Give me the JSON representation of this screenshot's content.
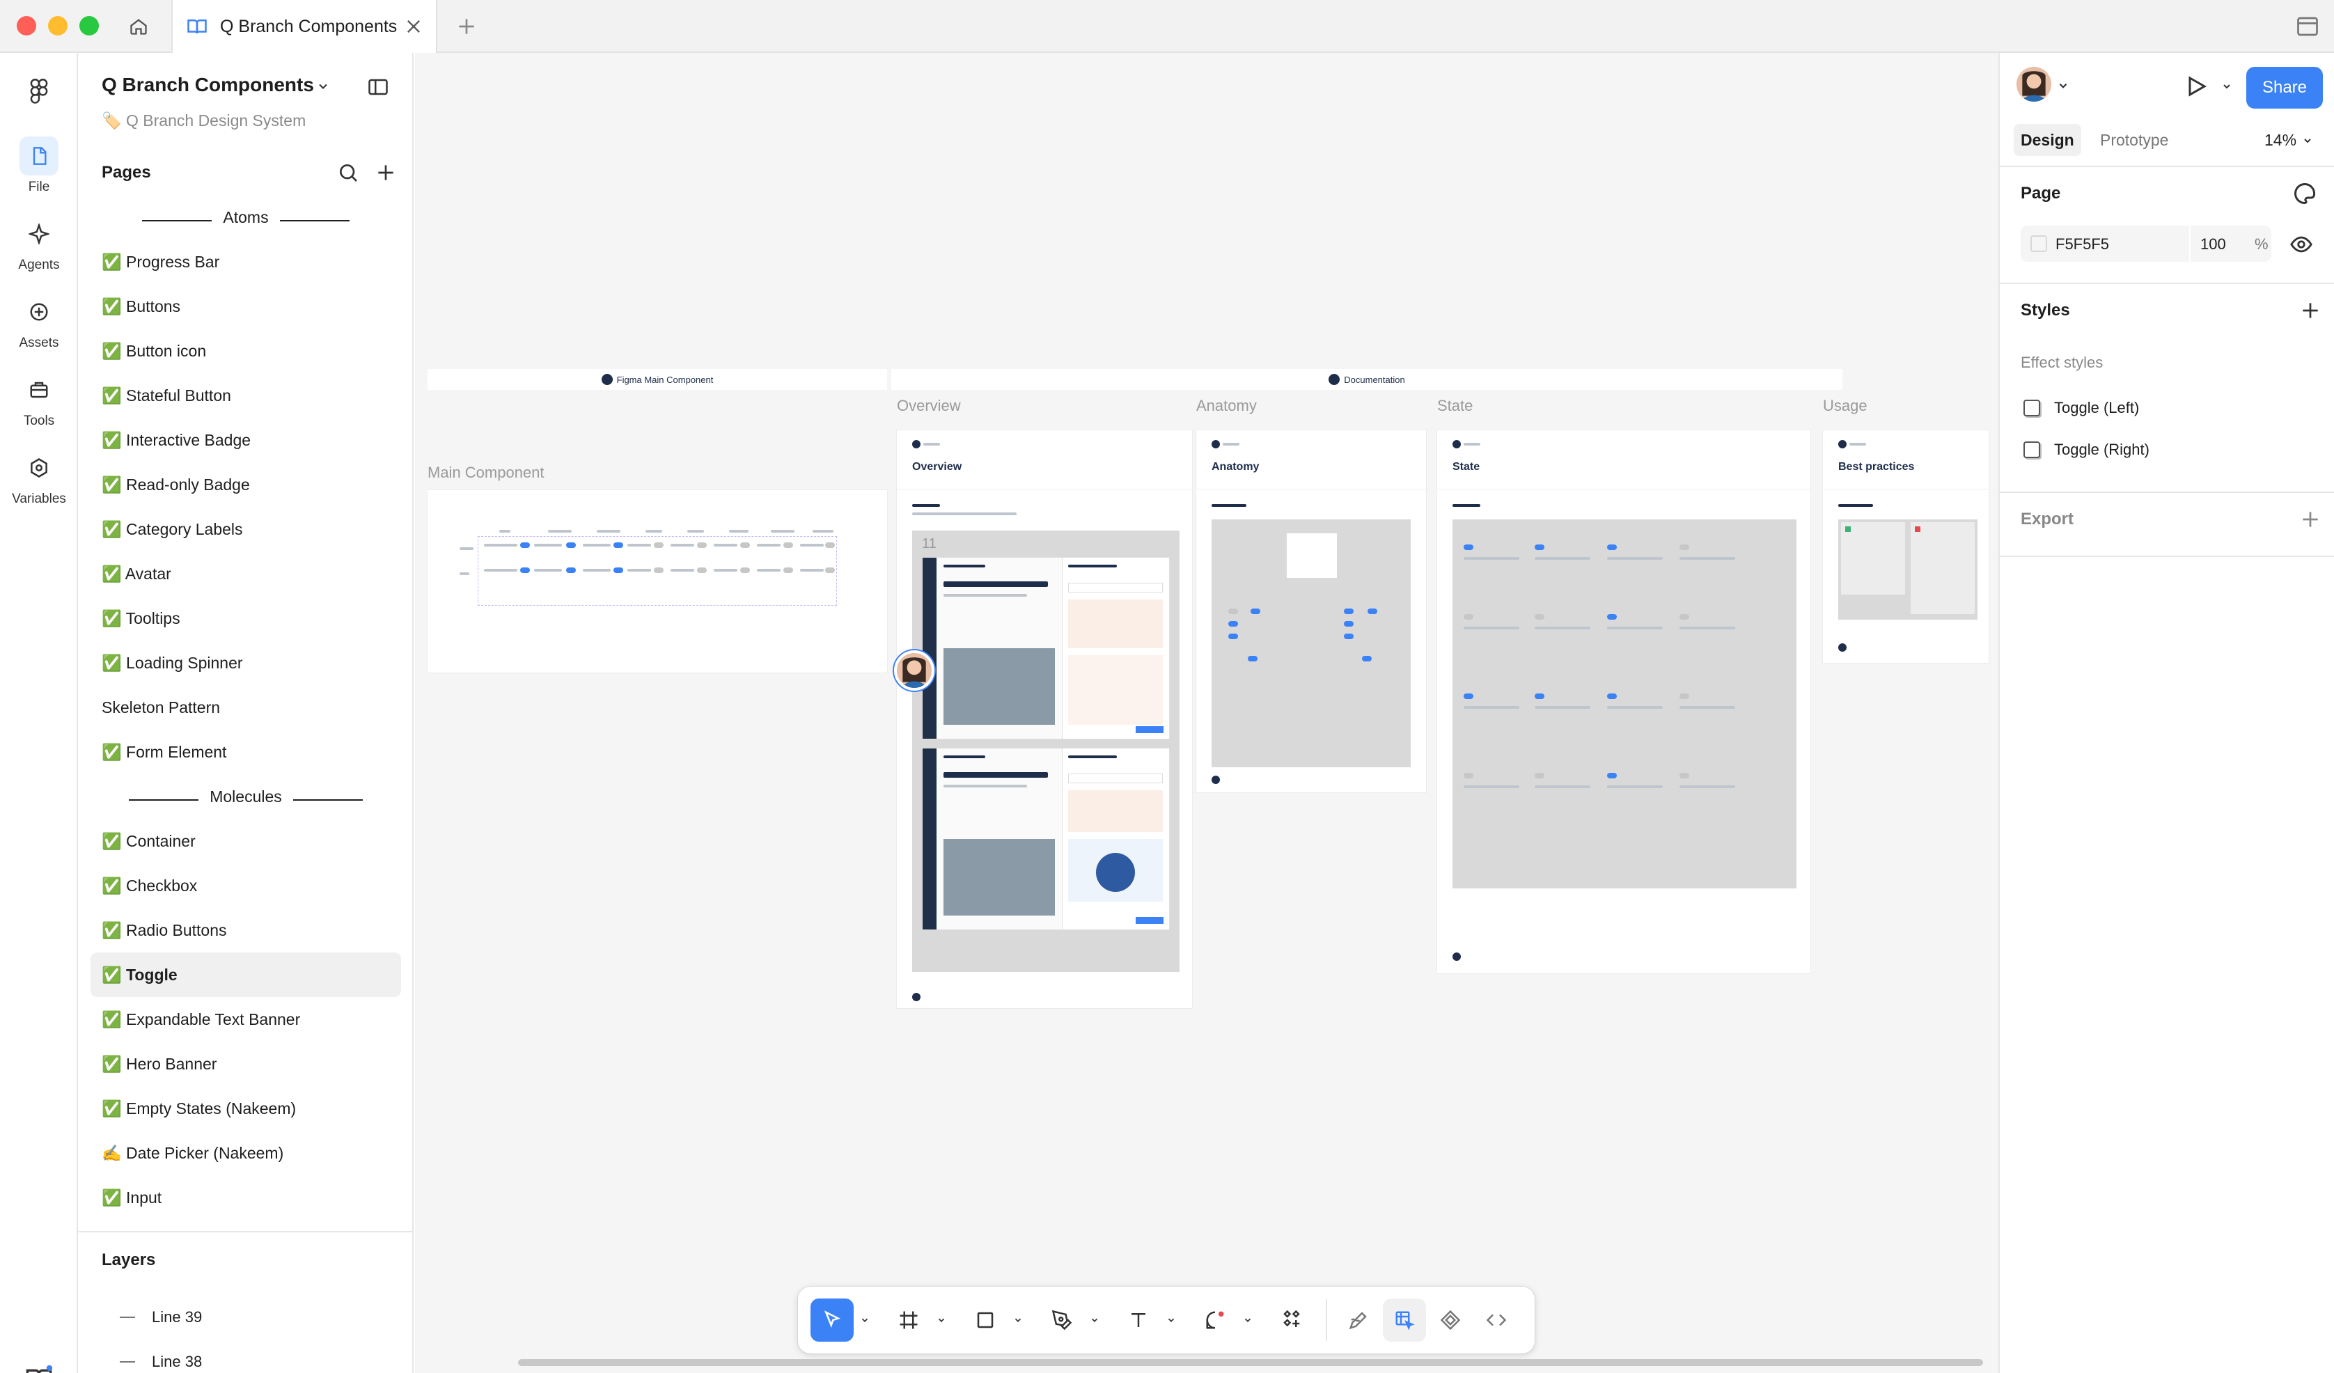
{
  "titlebar": {
    "tab_title": "Q Branch Components"
  },
  "rail": {
    "items": [
      {
        "label": "File"
      },
      {
        "label": "Agents"
      },
      {
        "label": "Assets"
      },
      {
        "label": "Tools"
      },
      {
        "label": "Variables"
      }
    ]
  },
  "left_panel": {
    "file_title": "Q Branch Components",
    "file_subtitle": "🏷️ Q Branch Design System",
    "pages_header": "Pages",
    "pages": [
      {
        "label": "Atoms",
        "separator": true
      },
      {
        "label": "✅ Progress Bar"
      },
      {
        "label": "✅ Buttons"
      },
      {
        "label": "✅ Button icon"
      },
      {
        "label": "✅ Stateful Button"
      },
      {
        "label": "✅ Interactive Badge"
      },
      {
        "label": "✅ Read-only Badge"
      },
      {
        "label": "✅ Category Labels"
      },
      {
        "label": "✅ Avatar"
      },
      {
        "label": "✅ Tooltips"
      },
      {
        "label": "✅ Loading Spinner"
      },
      {
        "label": "Skeleton Pattern"
      },
      {
        "label": "✅ Form Element"
      },
      {
        "label": "Molecules",
        "separator": true
      },
      {
        "label": "✅  Container"
      },
      {
        "label": "✅ Checkbox"
      },
      {
        "label": "✅ Radio Buttons"
      },
      {
        "label": "✅ Toggle",
        "selected": true
      },
      {
        "label": "✅ Expandable Text Banner"
      },
      {
        "label": "✅ Hero Banner"
      },
      {
        "label": "✅ Empty States (Nakeem)"
      },
      {
        "label": "✍️ Date Picker (Nakeem)"
      },
      {
        "label": "✅ Input"
      }
    ],
    "layers_header": "Layers",
    "layers": [
      {
        "label": "Line 39"
      },
      {
        "label": "Line 38"
      }
    ]
  },
  "canvas": {
    "section_main": "Figma Main Component",
    "section_docs": "Documentation",
    "frame_labels": {
      "main_component": "Main Component",
      "overview": "Overview",
      "anatomy": "Anatomy",
      "state": "State",
      "usage": "Usage"
    },
    "frame_titles": {
      "overview": "Overview",
      "anatomy": "Anatomy",
      "state": "State",
      "usage": "Best practices"
    },
    "overview_number": "11"
  },
  "toolbar": {
    "tools": [
      "move-icon",
      "frame-icon",
      "rectangle-icon",
      "pen-icon",
      "text-icon",
      "comment-icon",
      "components-icon"
    ],
    "modes": [
      "draw-icon",
      "design-mode-icon",
      "dev-components-icon",
      "code-icon"
    ]
  },
  "right_panel": {
    "share_label": "Share",
    "tab_design": "Design",
    "tab_prototype": "Prototype",
    "zoom": "14%",
    "page_header": "Page",
    "page_color": "F5F5F5",
    "page_opacity": "100",
    "page_opacity_unit": "%",
    "styles_header": "Styles",
    "effect_styles_label": "Effect styles",
    "effect_styles": [
      {
        "label": "Toggle (Left)"
      },
      {
        "label": "Toggle (Right)"
      }
    ],
    "export_header": "Export"
  },
  "colors": {
    "accent": "#3B82F6",
    "canvas_bg": "#F5F5F5",
    "selected_rail": "#E5F0FE"
  },
  "help_label": "?"
}
